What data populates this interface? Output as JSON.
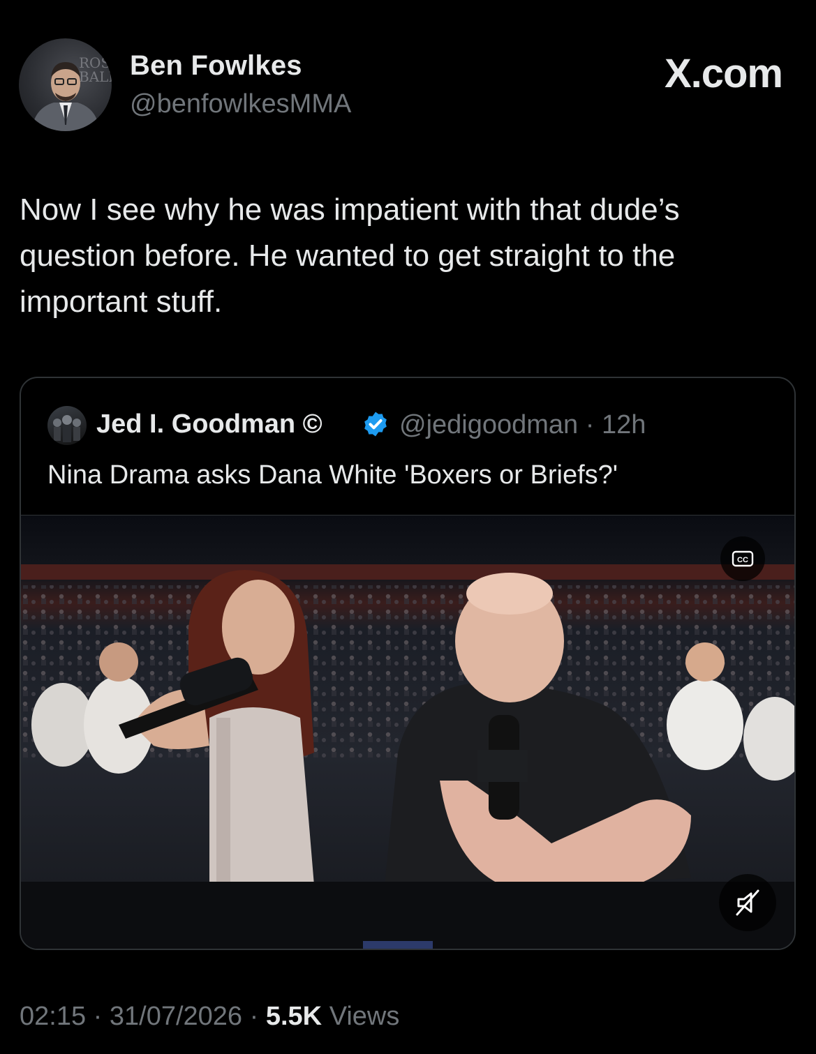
{
  "author": {
    "name": "Ben Fowlkes",
    "handle": "@benfowlkesMMA"
  },
  "brand": "X.com",
  "tweet": {
    "text": "Now I see why he was impatient with that dude’s question before. He wanted to get straight to the important stuff."
  },
  "quote": {
    "author_name": "Jed I. Goodman ©",
    "handle_time": "@jedigoodman · 12h",
    "text": "Nina Drama asks Dana White 'Boxers or Briefs?'",
    "video": {
      "captions_icon": "cc-icon",
      "mute_icon": "muted-speaker-icon"
    }
  },
  "meta": {
    "time": "02:15",
    "date": "31/07/2026",
    "views_count": "5.5K",
    "views_label": "Views",
    "separator": "·"
  },
  "colors": {
    "background": "#000000",
    "text_primary": "#e7e9ea",
    "text_secondary": "#71767b",
    "border": "#2f3336",
    "verified": "#1d9bf0"
  }
}
